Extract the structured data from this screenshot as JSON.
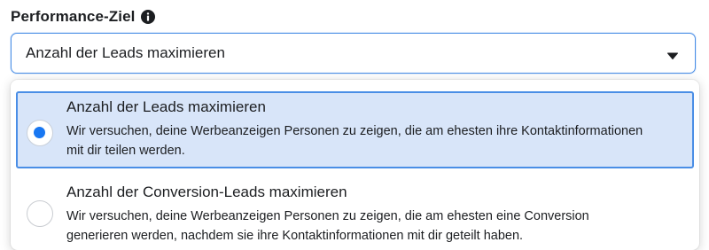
{
  "field": {
    "label": "Performance-Ziel",
    "info_icon": "info-icon",
    "selected_value": "Anzahl der Leads maximieren",
    "caret_icon": "caret-down-icon"
  },
  "options": [
    {
      "title": "Anzahl der Leads maximieren",
      "description": "Wir versuchen, deine Werbeanzeigen Personen zu zeigen, die am ehesten ihre Kontaktinformationen mit dir teilen werden.",
      "selected": true
    },
    {
      "title": "Anzahl der Conversion-Leads maximieren",
      "description": "Wir versuchen, deine Werbeanzeigen Personen zu zeigen, die am ehesten eine Conversion generieren werden, nachdem sie ihre Kontaktinformationen mit dir geteilt haben.",
      "selected": false
    }
  ],
  "colors": {
    "accent": "#1877f2",
    "focus_border": "#4a8ee6",
    "selected_bg": "#d8e5f9",
    "text": "#1c1e21"
  }
}
